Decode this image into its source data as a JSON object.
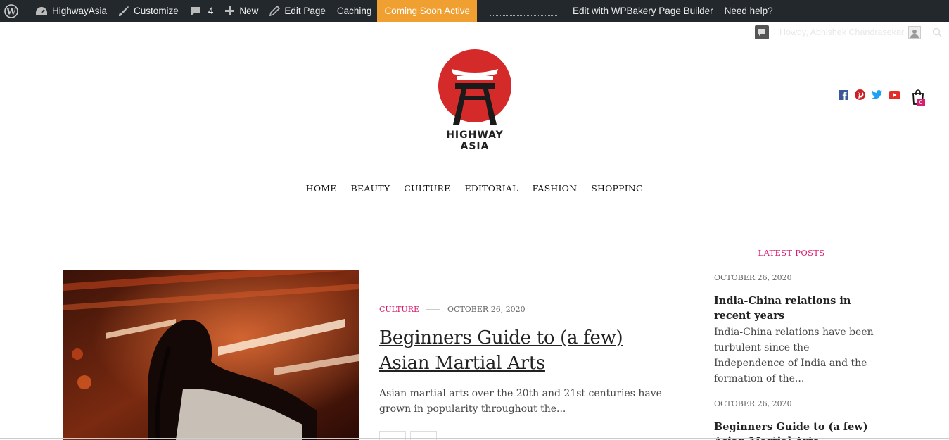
{
  "adminbar": {
    "site_name": "HighwayAsia",
    "customize": "Customize",
    "comments_count": "4",
    "new": "New",
    "edit_page": "Edit Page",
    "caching": "Caching",
    "coming_soon": "Coming Soon Active",
    "wpbakery": "Edit with WPBakery Page Builder",
    "help": "Need help?",
    "howdy": "Howdy, Abhishek Chandrasekar"
  },
  "logo": {
    "text": "HIGHWAY ASIA",
    "red": "#d42a2a"
  },
  "cart": {
    "count": "0"
  },
  "colors": {
    "accent": "#d91e6e",
    "adminbar": "#23282d",
    "coming_soon": "#f0a030"
  },
  "social": [
    "facebook-icon",
    "pinterest-icon",
    "twitter-icon",
    "youtube-icon"
  ],
  "nav": [
    "HOME",
    "BEAUTY",
    "CULTURE",
    "EDITORIAL",
    "FASHION",
    "SHOPPING"
  ],
  "article": {
    "category": "CULTURE",
    "date": "OCTOBER 26, 2020",
    "title": "Beginners Guide to (a few) Asian Martial Arts",
    "excerpt": "Asian martial arts over the 20th and 21st centuries have grown in popularity throughout the..."
  },
  "sidebar": {
    "heading": "LATEST POSTS",
    "posts": [
      {
        "date": "OCTOBER 26, 2020",
        "title": "India-China relations in recent years",
        "excerpt": "India-China relations have been turbulent since the Independence of India and the formation of the..."
      },
      {
        "date": "OCTOBER 26, 2020",
        "title": "Beginners Guide to (a few) Asian Martial Arts",
        "excerpt": ""
      }
    ]
  }
}
